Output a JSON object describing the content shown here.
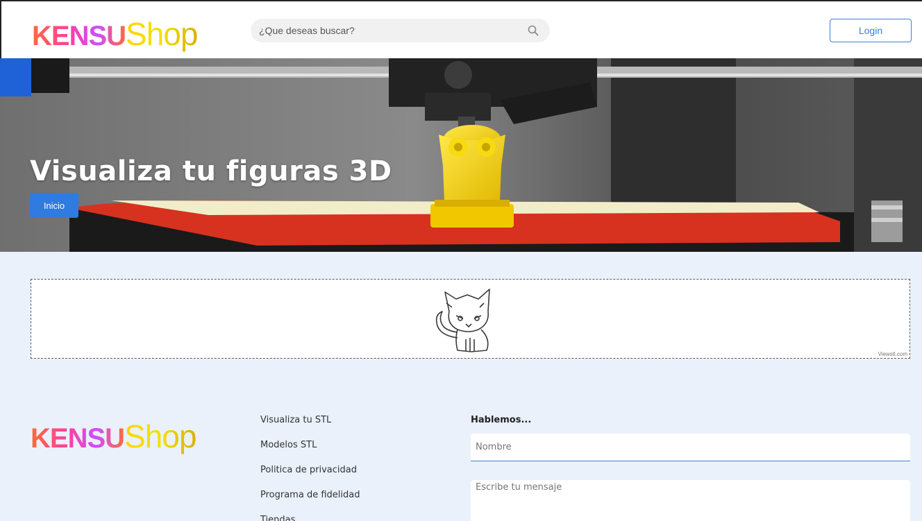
{
  "header": {
    "logo_part1": "KENSU",
    "logo_part2": "Shop",
    "search_placeholder": "¿Que deseas buscar?",
    "search_icon": "search-icon",
    "login_label": "Login"
  },
  "hero": {
    "title": "Visualiza tu figuras 3D",
    "button_label": "Inicio"
  },
  "viewer": {
    "credit": "Viewstl.com",
    "model_icon": "fox-model-icon"
  },
  "footer": {
    "logo_part1": "KENSU",
    "logo_part2": "Shop",
    "links": [
      "Visualiza tu STL",
      "Modelos STL",
      "Politica de privacidad",
      "Programa de fidelidad",
      "Tiendas"
    ],
    "form_title": "Hablemos...",
    "name_placeholder": "Nombre",
    "message_placeholder": "Escribe tu mensaje"
  },
  "colors": {
    "accent": "#2f7be0",
    "page_background": "#eaf1fb",
    "header_background": "#ffffff"
  }
}
